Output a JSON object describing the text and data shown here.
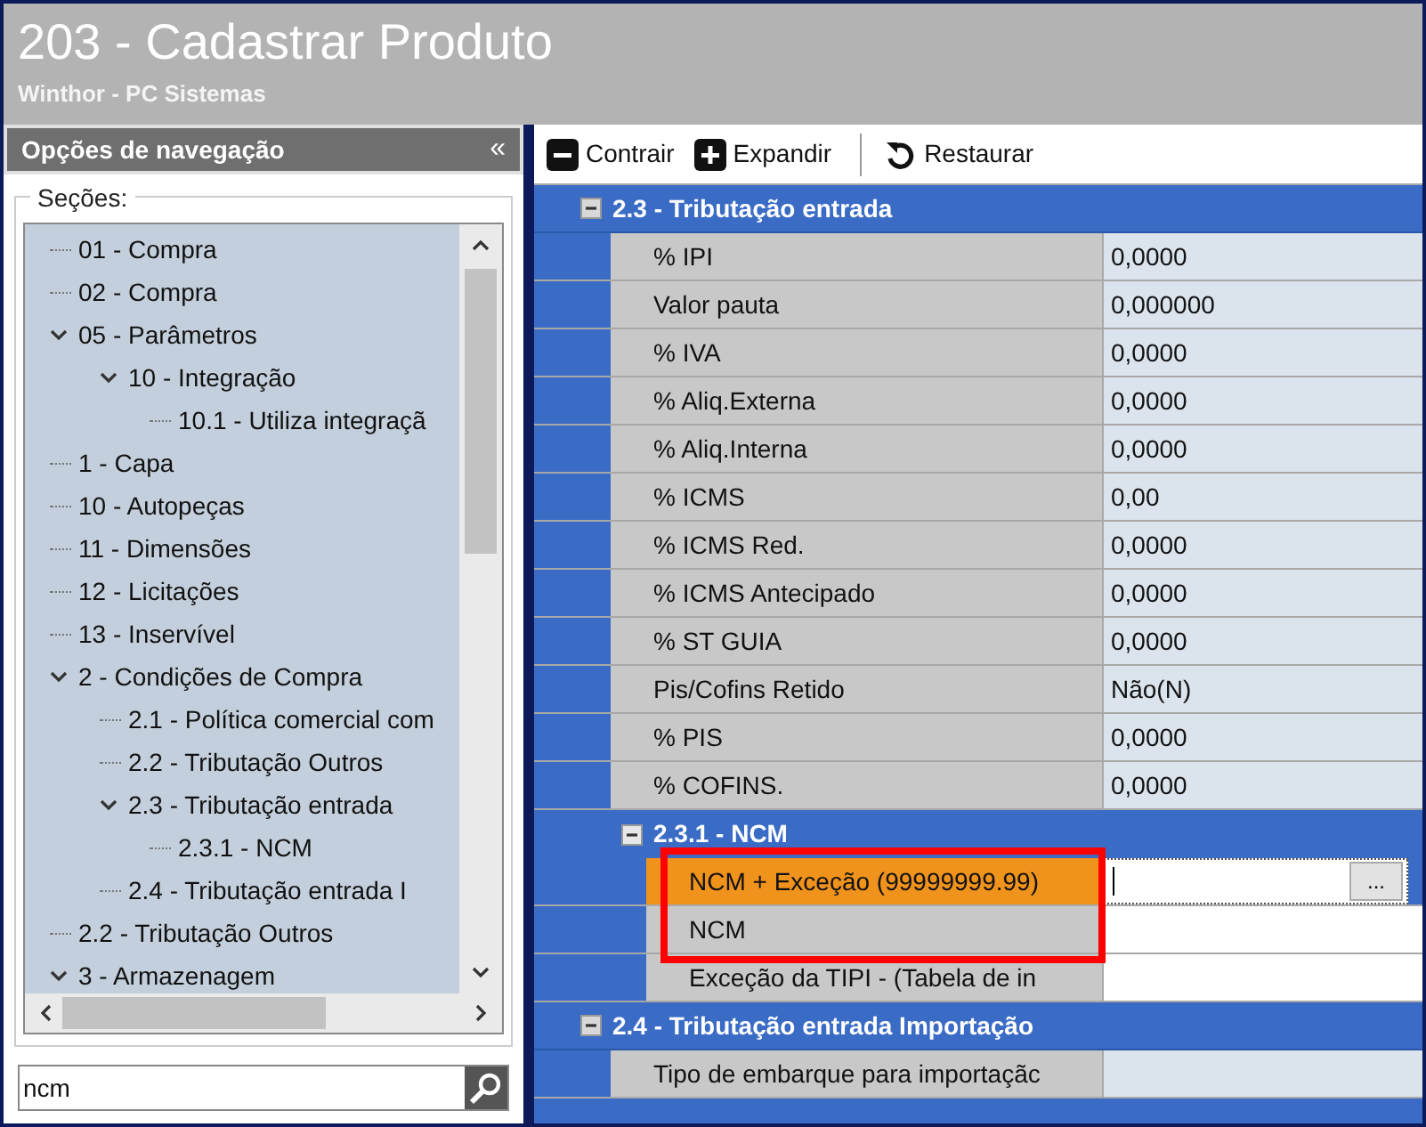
{
  "window": {
    "title": "203 - Cadastrar  Produto",
    "subtitle": "Winthor - PC Sistemas"
  },
  "nav": {
    "title": "Opções de navegação",
    "collapse": "«",
    "group_label": "Seções:",
    "search": {
      "value": "ncm"
    },
    "tree": [
      {
        "label": "01 - Compra"
      },
      {
        "label": "02 - Compra"
      },
      {
        "label": "05 - Parâmetros",
        "expanded": true,
        "children": [
          {
            "label": "10 - Integração",
            "expanded": true,
            "children": [
              {
                "label": "10.1 - Utiliza integraçã"
              }
            ]
          }
        ]
      },
      {
        "label": "1 - Capa"
      },
      {
        "label": "10 - Autopeças"
      },
      {
        "label": "11 - Dimensões"
      },
      {
        "label": "12 - Licitações"
      },
      {
        "label": "13 - Inservível"
      },
      {
        "label": "2 - Condições de Compra",
        "expanded": true,
        "children": [
          {
            "label": "2.1 - Política comercial com"
          },
          {
            "label": "2.2 - Tributação Outros"
          },
          {
            "label": "2.3 - Tributação entrada",
            "expanded": true,
            "children": [
              {
                "label": "2.3.1 - NCM"
              }
            ]
          },
          {
            "label": "2.4 - Tributação entrada I"
          }
        ]
      },
      {
        "label": "2.2 - Tributação Outros"
      },
      {
        "label": "3 - Armazenagem",
        "expanded": true
      }
    ]
  },
  "toolbar": [
    {
      "kind": "collapse",
      "label": "Contrair"
    },
    {
      "kind": "expand",
      "label": "Expandir"
    },
    {
      "kind": "restore",
      "label": "Restaurar"
    }
  ],
  "sections": [
    {
      "title": "2.3 - Tributação entrada",
      "expanded": true,
      "rows": [
        {
          "label": "% IPI",
          "value": "0,0000"
        },
        {
          "label": "Valor pauta",
          "value": "0,000000"
        },
        {
          "label": "% IVA",
          "value": "0,0000"
        },
        {
          "label": "% Aliq.Externa",
          "value": "0,0000"
        },
        {
          "label": "% Aliq.Interna",
          "value": "0,0000"
        },
        {
          "label": "% ICMS",
          "value": "0,00"
        },
        {
          "label": "% ICMS Red.",
          "value": "0,0000"
        },
        {
          "label": "% ICMS Antecipado",
          "value": "0,0000"
        },
        {
          "label": "% ST GUIA",
          "value": "0,0000"
        },
        {
          "label": "Pis/Cofins Retido",
          "value": "Não(N)"
        },
        {
          "label": "% PIS",
          "value": "0,0000"
        },
        {
          "label": "% COFINS.",
          "value": "0,0000"
        }
      ],
      "subsections": [
        {
          "title": "2.3.1 - NCM",
          "expanded": true,
          "rows": [
            {
              "label": "NCM + Exceção (99999999.99)",
              "kind": "lookup",
              "button": "...",
              "selected": true,
              "highlighted": true
            },
            {
              "label": "NCM",
              "selected": false,
              "highlighted": true
            },
            {
              "label": "Exceção da TIPI - (Tabela de in",
              "selected": false,
              "highlighted": false
            }
          ]
        }
      ]
    },
    {
      "title": "2.4 - Tributação entrada Importação",
      "expanded": true,
      "rows": [
        {
          "label": "Tipo de embarque para importaçãc",
          "value": ""
        }
      ]
    }
  ]
}
